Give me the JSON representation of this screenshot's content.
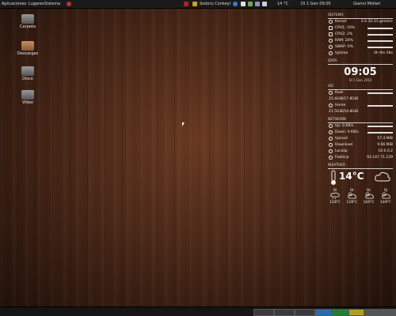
{
  "topbar": {
    "menu_left": "Aplicaciones",
    "menu_places": "Lugares",
    "menu_system": "Sistema",
    "window_title": "Sodoru Conkeyl",
    "temp": "14 °C",
    "clock": "Dl 1 Gen 09:05",
    "user": "Gianni Mollari"
  },
  "desktop_icons": [
    {
      "label": "Carpeta",
      "icon": "drive-icon"
    },
    {
      "label": "Descargas",
      "icon": "folder-icon"
    },
    {
      "label": "Disco",
      "icon": "drive-icon"
    },
    {
      "label": "Video",
      "icon": "drive-icon"
    }
  ],
  "conky": {
    "system_title": "SISTEMA",
    "system_rows": [
      {
        "label": "Kernel",
        "value": "2.6.32-21-generic"
      },
      {
        "label": "CPU1: 10%",
        "value": "",
        "level": 0.1
      },
      {
        "label": "CPU2: 2%",
        "value": "",
        "level": 0.02
      },
      {
        "label": "RAM: 20%",
        "value": "",
        "level": 0.2
      },
      {
        "label": "SWAP: 0%",
        "value": "",
        "level": 0.0
      },
      {
        "label": "Uptime",
        "value": "0h 9m 56s"
      }
    ],
    "date_title": "DATA",
    "time": "09:05",
    "date": "Dl 1 Gen 2010",
    "hd_title": "HD",
    "hd_rows": [
      {
        "label": "Root",
        "level": 0.3
      },
      {
        "label": "15.4GiB/17.8GiB",
        "value": ""
      },
      {
        "label": "Home",
        "level": 0.6
      },
      {
        "label": "21.5GiB/54.8GiB",
        "value": ""
      }
    ],
    "network_title": "NETWORK",
    "network_rows": [
      {
        "label": "Up: 0 KB/s",
        "value": ""
      },
      {
        "label": "Down: 0 KB/s",
        "value": ""
      },
      {
        "label": "Upload",
        "value": "57.4 MiB"
      },
      {
        "label": "Download",
        "value": "9.66 MiB"
      },
      {
        "label": "Localip",
        "value": "10.0.0.2"
      },
      {
        "label": "Publicip",
        "value": "93.147.71.129"
      }
    ],
    "weather_title": "WEATHER",
    "weather_temp": "14°C",
    "forecast": [
      {
        "day": "Dl",
        "temp": "12/8°C"
      },
      {
        "day": "Dt",
        "temp": "13/9°C"
      },
      {
        "day": "Dc",
        "temp": "14/9°C"
      },
      {
        "day": "Dj",
        "temp": "14/9°C"
      }
    ]
  },
  "colors": {
    "wood_mid": "#4a2818",
    "panel": "#1a1a1a"
  }
}
